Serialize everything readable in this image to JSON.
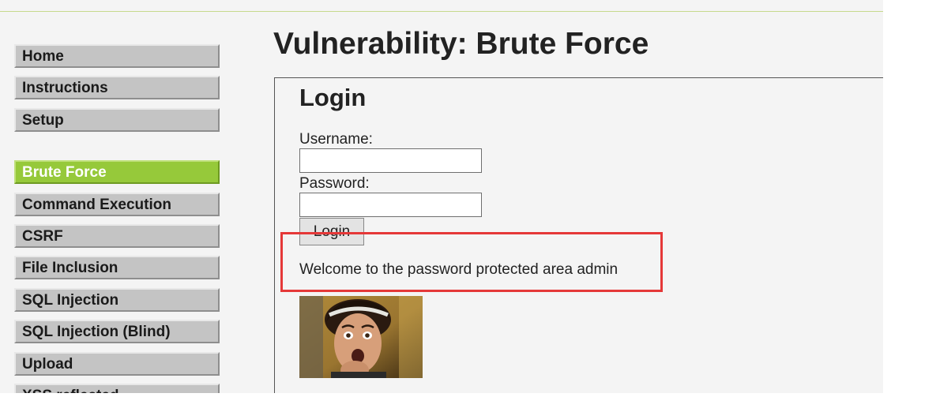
{
  "sidebar": {
    "items": [
      {
        "label": "Home"
      },
      {
        "label": "Instructions"
      },
      {
        "label": "Setup"
      },
      {
        "label": "Brute Force",
        "active": true
      },
      {
        "label": "Command Execution"
      },
      {
        "label": "CSRF"
      },
      {
        "label": "File Inclusion"
      },
      {
        "label": "SQL Injection"
      },
      {
        "label": "SQL Injection (Blind)"
      },
      {
        "label": "Upload"
      },
      {
        "label": "XSS reflected"
      }
    ]
  },
  "main": {
    "title": "Vulnerability: Brute Force",
    "login": {
      "heading": "Login",
      "username_label": "Username:",
      "username_value": "",
      "password_label": "Password:",
      "password_value": "",
      "button_label": "Login"
    },
    "welcome_message": "Welcome to the password protected area admin"
  },
  "colors": {
    "accent_active": "#96c93a",
    "menu_bg": "#c4c4c4",
    "page_bg": "#f4f4f4",
    "highlight": "#e53838"
  },
  "icons": {
    "avatar": "user-photo-surprised"
  }
}
